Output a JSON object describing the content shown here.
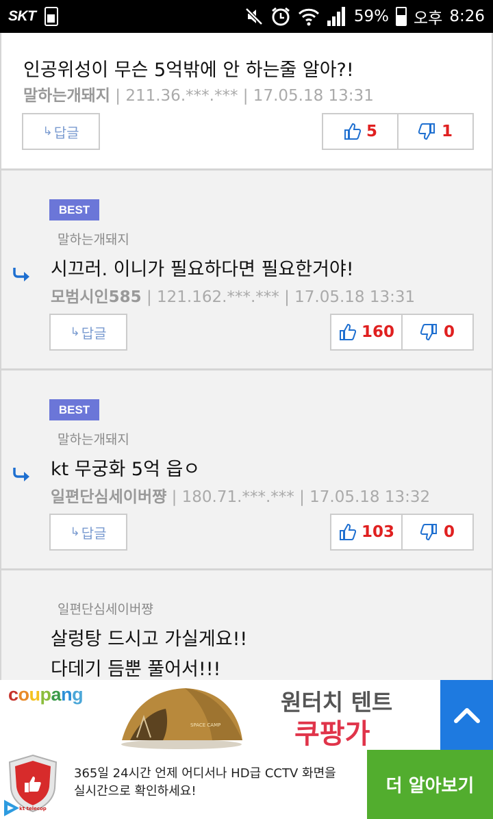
{
  "status_bar": {
    "carrier": "SKT",
    "battery": "59%",
    "battery_level": 0.59,
    "ampm": "오후",
    "time": "8:26"
  },
  "comments": [
    {
      "text": "인공위성이 무슨 5억밖에 안 하는줄 알아?!",
      "nick": "말하는개돼지",
      "meta": " | 211.36.***.*** | 17.05.18 13:31",
      "reply_label": "답글",
      "up": "5",
      "down": "1"
    },
    {
      "badge": "BEST",
      "parent": "말하는개돼지",
      "text": "시끄러. 이니가 필요하다면 필요한거야!",
      "nick": "모범시인585",
      "meta": " | 121.162.***.*** | 17.05.18 13:31",
      "reply_label": "답글",
      "up": "160",
      "down": "0"
    },
    {
      "badge": "BEST",
      "parent": "말하는개돼지",
      "text": "kt 무궁화 5억 읍ㅇ",
      "nick": "일편단심세이버쨩",
      "meta": " | 180.71.***.*** | 17.05.18 13:32",
      "reply_label": "답글",
      "up": "103",
      "down": "0"
    },
    {
      "parent": "일편단심세이버쨩",
      "line1": "살렁탕 드시고 가실게요!!",
      "line2": "다데기 듬뿐 풀어서!!!"
    }
  ],
  "ad_banner": {
    "brand": "coupang",
    "title": "원터치 텐트",
    "price": "쿠팡가",
    "tent_label": "SPACE CAMP",
    "colors": {
      "c": "#c6332b",
      "o": "#e88a2a",
      "u": "#f4c21f",
      "p": "#8bbd3c",
      "a": "#3a9a4a",
      "n": "#2c8fd6",
      "g": "#4ca7d8"
    }
  },
  "bottom_ad": {
    "brand": "kt telecop",
    "desc_line1": "365일 24시간 언제 어디서나 HD급 CCTV 화면을",
    "desc_line2": "실시간으로 확인하세요!",
    "cta": "더 알아보기"
  }
}
